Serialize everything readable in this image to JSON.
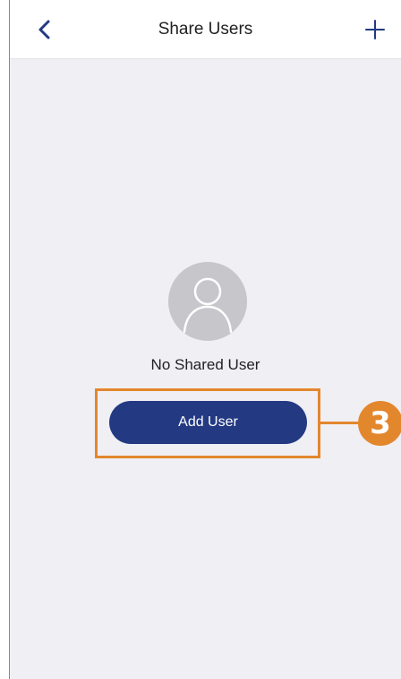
{
  "header": {
    "title": "Share Users",
    "back_icon": "chevron-left-icon",
    "add_icon": "plus-icon"
  },
  "main": {
    "avatar_icon": "user-avatar-icon",
    "empty_message": "No Shared User",
    "add_user_label": "Add User"
  },
  "annotation": {
    "step_number": "3"
  },
  "colors": {
    "accent": "#233a83",
    "highlight": "#e3872d",
    "background": "#f0eff4",
    "avatar_bg": "#c6c6cb"
  }
}
